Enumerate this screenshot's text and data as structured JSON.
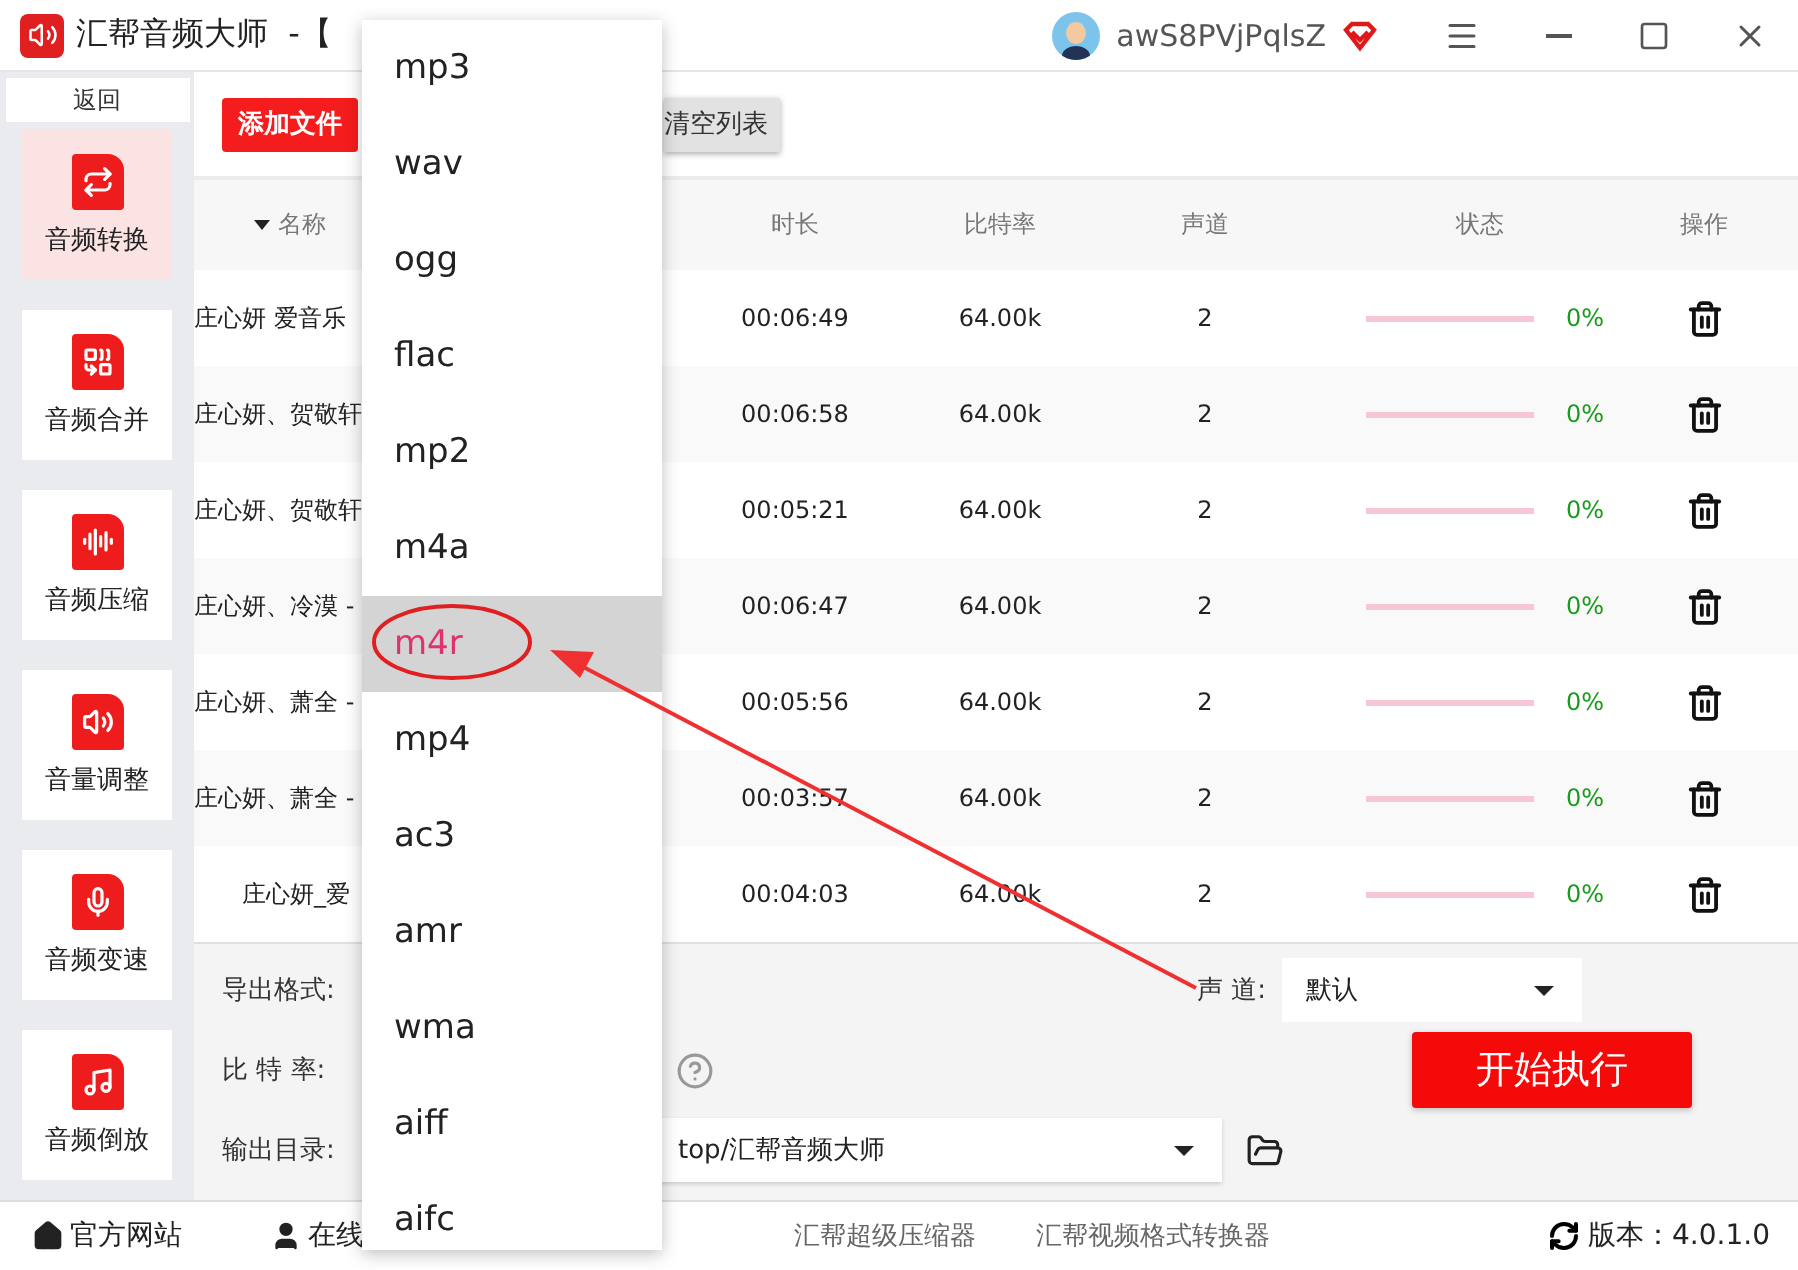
{
  "window": {
    "title": "汇帮音频大师  -【",
    "user": "awS8PVjPqlsZ"
  },
  "sidebar": {
    "back": "返回",
    "items": [
      {
        "label": "音频转换",
        "selected": true
      },
      {
        "label": "音频合并",
        "selected": false
      },
      {
        "label": "音频压缩",
        "selected": false
      },
      {
        "label": "音量调整",
        "selected": false
      },
      {
        "label": "音频变速",
        "selected": false
      },
      {
        "label": "音频倒放",
        "selected": false
      }
    ]
  },
  "toolbar": {
    "add": "添加文件",
    "clear": "清空列表"
  },
  "table": {
    "columns": [
      "名称",
      "时长",
      "比特率",
      "声道",
      "状态",
      "操作"
    ],
    "rows": [
      {
        "name": "庄心妍 爱音乐",
        "duration": "00:06:49",
        "bitrate": "64.00k",
        "channels": "2",
        "level": 0,
        "progress": "0%"
      },
      {
        "name": "庄心妍、贺敬轩",
        "duration": "00:06:58",
        "bitrate": "64.00k",
        "channels": "2",
        "level": 0,
        "progress": "0%"
      },
      {
        "name": "庄心妍、贺敬轩",
        "duration": "00:05:21",
        "bitrate": "64.00k",
        "channels": "2",
        "level": 0,
        "progress": "0%"
      },
      {
        "name": "庄心妍、冷漠 -",
        "duration": "00:06:47",
        "bitrate": "64.00k",
        "channels": "2",
        "level": 0,
        "progress": "0%"
      },
      {
        "name": "庄心妍、萧全 -",
        "duration": "00:05:56",
        "bitrate": "64.00k",
        "channels": "2",
        "level": 0,
        "progress": "0%"
      },
      {
        "name": "庄心妍、萧全 -",
        "duration": "00:03:57",
        "bitrate": "64.00k",
        "channels": "2",
        "level": 0,
        "progress": "0%"
      },
      {
        "name": "庄心妍_爱",
        "duration": "00:04:03",
        "bitrate": "64.00k",
        "channels": "2",
        "level": 0,
        "progress": "0%"
      }
    ]
  },
  "settings": {
    "format_label": "导出格式:",
    "bitrate_label": "比 特 率:",
    "output_label": "输出目录:",
    "output_path": "top/汇帮音频大师",
    "channel_label": "声 道:",
    "channel_value": "默认",
    "start": "开始执行"
  },
  "dropdown": {
    "items": [
      {
        "label": "mp3",
        "selected": false
      },
      {
        "label": "wav",
        "selected": false
      },
      {
        "label": "ogg",
        "selected": false
      },
      {
        "label": "flac",
        "selected": false
      },
      {
        "label": "mp2",
        "selected": false
      },
      {
        "label": "m4a",
        "selected": false
      },
      {
        "label": "m4r",
        "selected": true
      },
      {
        "label": "mp4",
        "selected": false
      },
      {
        "label": "ac3",
        "selected": false
      },
      {
        "label": "amr",
        "selected": false
      },
      {
        "label": "wma",
        "selected": false
      },
      {
        "label": "aiff",
        "selected": false
      },
      {
        "label": "aifc",
        "selected": false
      }
    ]
  },
  "footer": {
    "website": "官方网站",
    "support": "在线",
    "links": [
      "汇帮超级压缩器",
      "汇帮视频格式转换器"
    ],
    "version": "版本：4.0.1.0"
  }
}
